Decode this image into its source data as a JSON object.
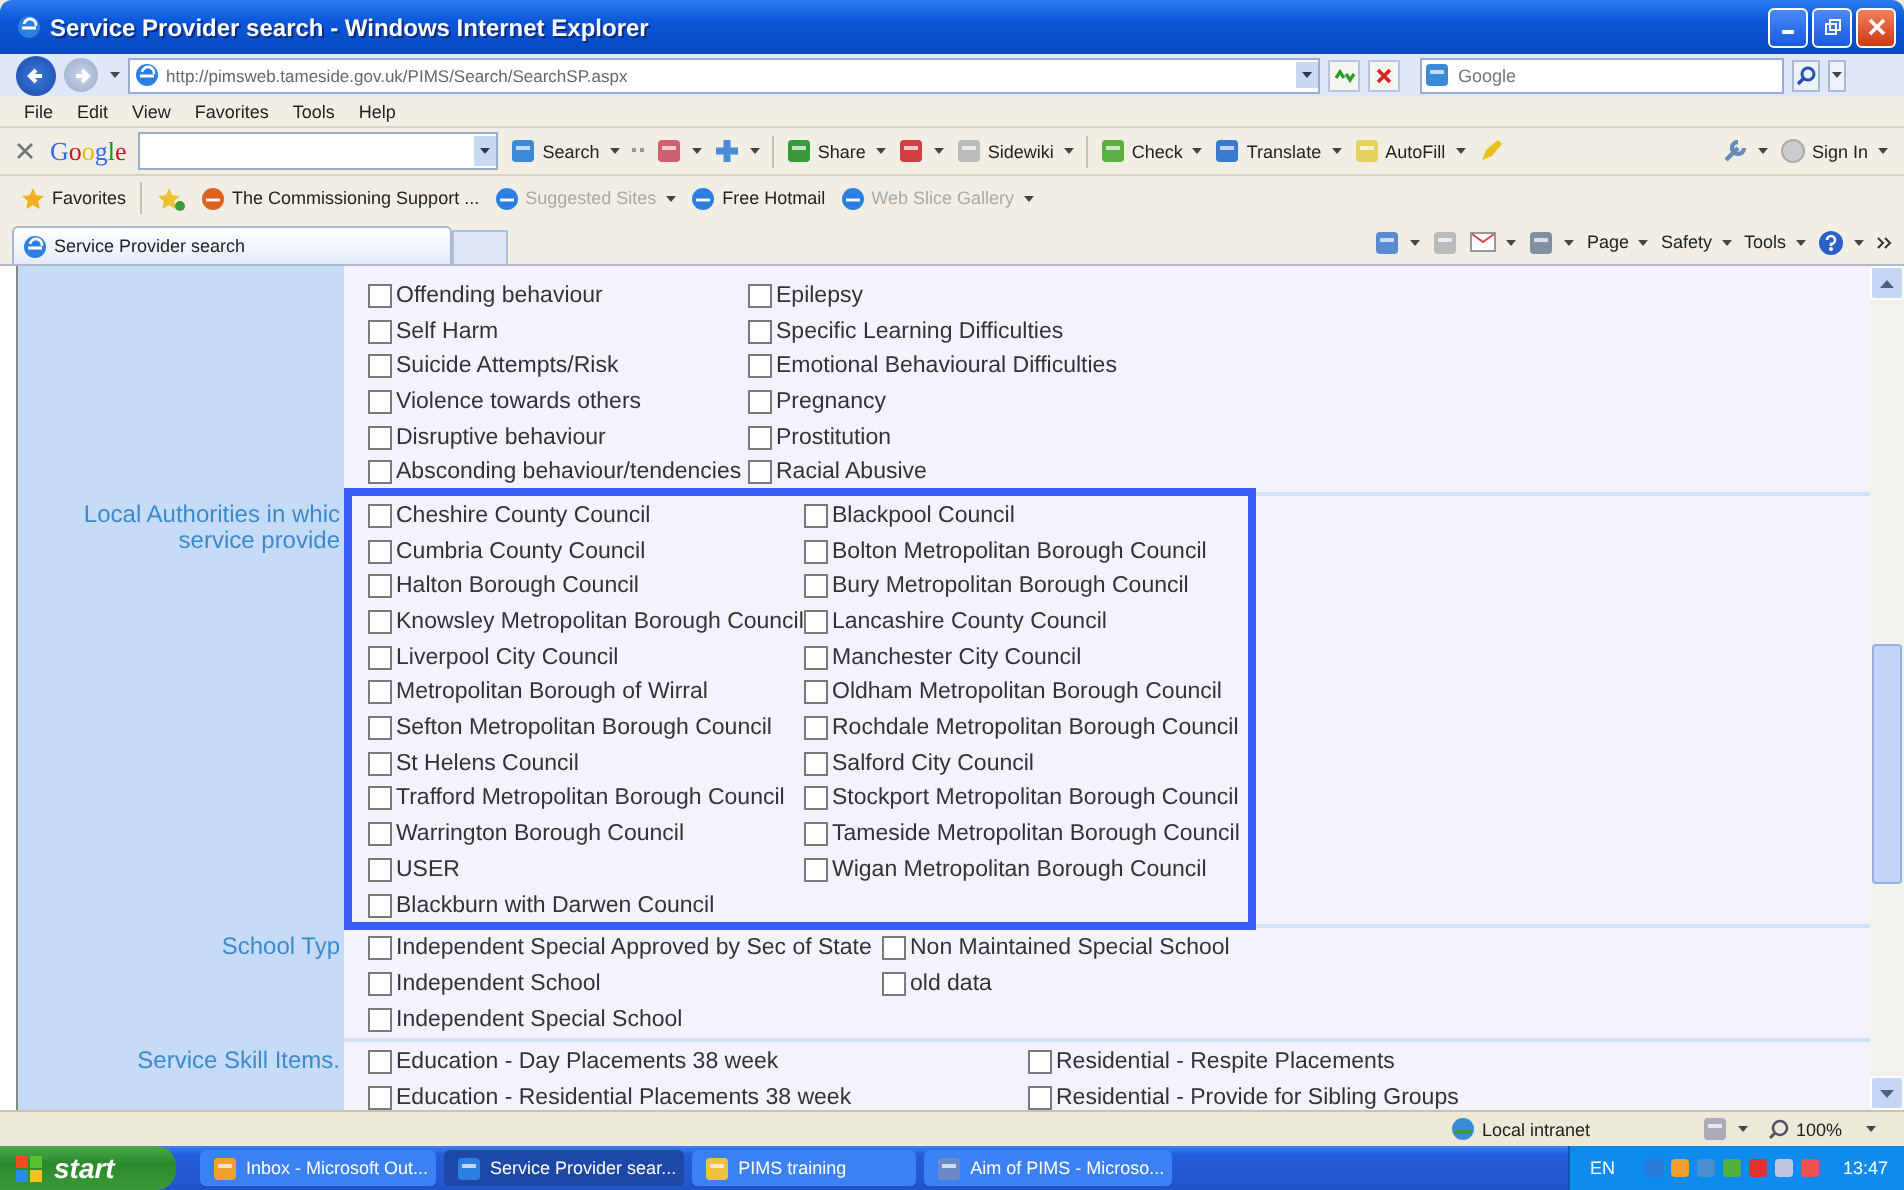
{
  "window": {
    "title": "Service Provider search - Windows Internet Explorer"
  },
  "address_bar": {
    "url": "http://pimsweb.tameside.gov.uk/PIMS/Search/SearchSP.aspx",
    "search_placeholder": "Google"
  },
  "menu": [
    "File",
    "Edit",
    "View",
    "Favorites",
    "Tools",
    "Help"
  ],
  "google_toolbar": {
    "logo": "Google",
    "buttons": [
      {
        "label": "Search"
      },
      {
        "label": "Share"
      },
      {
        "label": "Sidewiki"
      },
      {
        "label": "Check"
      },
      {
        "label": "Translate"
      },
      {
        "label": "AutoFill"
      }
    ],
    "sign_in": "Sign In"
  },
  "favorites_bar": {
    "label": "Favorites",
    "links": [
      {
        "label": "The Commissioning Support ...",
        "disabled": false
      },
      {
        "label": "Suggested Sites",
        "disabled": true
      },
      {
        "label": "Free Hotmail",
        "disabled": false
      },
      {
        "label": "Web Slice Gallery",
        "disabled": true
      }
    ]
  },
  "tab": {
    "label": "Service Provider search"
  },
  "command_bar": [
    "Page",
    "Safety",
    "Tools"
  ],
  "content": {
    "sections": [
      {
        "columns": [
          [
            {
              "label": "Offending behaviour",
              "checked": false
            },
            {
              "label": "Self Harm",
              "checked": false
            },
            {
              "label": "Suicide Attempts/Risk",
              "checked": false
            },
            {
              "label": "Violence towards others",
              "checked": false
            },
            {
              "label": "Disruptive behaviour",
              "checked": false
            },
            {
              "label": "Absconding behaviour/tendencies",
              "checked": false
            }
          ],
          [
            {
              "label": "Epilepsy",
              "checked": false
            },
            {
              "label": "Specific Learning Difficulties",
              "checked": false
            },
            {
              "label": "Emotional Behavioural Difficulties",
              "checked": false
            },
            {
              "label": "Pregnancy",
              "checked": false
            },
            {
              "label": "Prostitution",
              "checked": false
            },
            {
              "label": "Racial Abusive",
              "checked": false
            }
          ]
        ]
      },
      {
        "label": [
          "Local Authorities in whic",
          "service provide"
        ],
        "columns": [
          [
            {
              "label": "Cheshire County Council",
              "checked": false
            },
            {
              "label": "Cumbria County Council",
              "checked": false
            },
            {
              "label": "Halton Borough Council",
              "checked": false
            },
            {
              "label": "Knowsley Metropolitan Borough Council",
              "checked": false
            },
            {
              "label": "Liverpool City Council",
              "checked": false
            },
            {
              "label": "Metropolitan Borough of Wirral",
              "checked": false
            },
            {
              "label": "Sefton Metropolitan Borough Council",
              "checked": false
            },
            {
              "label": "St Helens Council",
              "checked": false
            },
            {
              "label": "Trafford Metropolitan Borough Council",
              "checked": false
            },
            {
              "label": "Warrington Borough Council",
              "checked": false
            },
            {
              "label": "USER",
              "checked": false
            },
            {
              "label": "Blackburn with Darwen Council",
              "checked": false
            }
          ],
          [
            {
              "label": "Blackpool Council",
              "checked": false
            },
            {
              "label": "Bolton Metropolitan Borough Council",
              "checked": false
            },
            {
              "label": "Bury Metropolitan Borough Council",
              "checked": false
            },
            {
              "label": "Lancashire County Council",
              "checked": false
            },
            {
              "label": "Manchester City Council",
              "checked": false
            },
            {
              "label": "Oldham Metropolitan Borough Council",
              "checked": false
            },
            {
              "label": "Rochdale Metropolitan Borough Council",
              "checked": false
            },
            {
              "label": "Salford City Council",
              "checked": false
            },
            {
              "label": "Stockport Metropolitan Borough Council",
              "checked": false
            },
            {
              "label": "Tameside Metropolitan Borough Council",
              "checked": false
            },
            {
              "label": "Wigan Metropolitan Borough Council",
              "checked": false
            }
          ]
        ]
      },
      {
        "label": [
          "School Typ"
        ],
        "columns": [
          [
            {
              "label": "Independent Special Approved by Sec of State",
              "checked": false
            },
            {
              "label": "Independent School",
              "checked": false
            },
            {
              "label": "Independent Special School",
              "checked": false
            }
          ],
          [
            {
              "label": "Non Maintained Special School",
              "checked": false
            },
            {
              "label": "old data",
              "checked": false
            }
          ]
        ]
      },
      {
        "label": [
          "Service Skill Items."
        ],
        "columns": [
          [
            {
              "label": "Education - Day Placements 38 week",
              "checked": false
            },
            {
              "label": "Education - Residential Placements 38 week",
              "checked": false
            }
          ],
          [
            {
              "label": "Residential - Respite Placements",
              "checked": false
            },
            {
              "label": "Residential - Provide for Sibling Groups",
              "checked": false
            }
          ]
        ]
      }
    ]
  },
  "status_bar": {
    "zone": "Local intranet",
    "zoom": "100%"
  },
  "taskbar": {
    "start": "start",
    "tasks": [
      {
        "label": "Inbox - Microsoft Out...",
        "selected": false
      },
      {
        "label": "Service Provider sear...",
        "selected": true
      },
      {
        "label": "PIMS training",
        "selected": false
      },
      {
        "label": "Aim of PIMS - Microso...",
        "selected": false
      }
    ],
    "language": "EN",
    "clock": "13:47"
  }
}
